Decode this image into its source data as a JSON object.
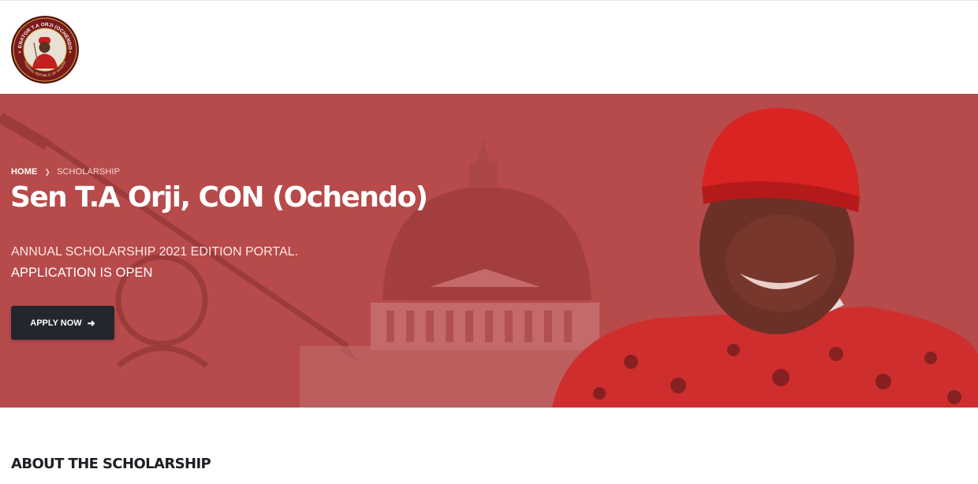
{
  "header": {
    "logo_text": {
      "arc_top": "SENATOR T.A ORJI (OCHENDO)",
      "arc_bottom": "FEDERAL REPUBLIC OF NIGERIA"
    }
  },
  "hero": {
    "breadcrumb": {
      "home": "HOME",
      "current": "SCHOLARSHIP"
    },
    "title": "Sen T.A Orji, CON (Ochendo)",
    "subtitle_line1": "ANNUAL SCHOLARSHIP 2021 EDITION PORTAL.",
    "subtitle_line2": "APPLICATION IS OPEN",
    "apply_button": "APPLY NOW",
    "apply_icon": "arrow-right-icon",
    "overlay_color": "#b84a4a"
  },
  "about": {
    "heading": "ABOUT THE SCHOLARSHIP"
  },
  "colors": {
    "hero_red": "#b84a4a",
    "button_dark": "#23272d",
    "text_dark": "#1d1f24"
  }
}
